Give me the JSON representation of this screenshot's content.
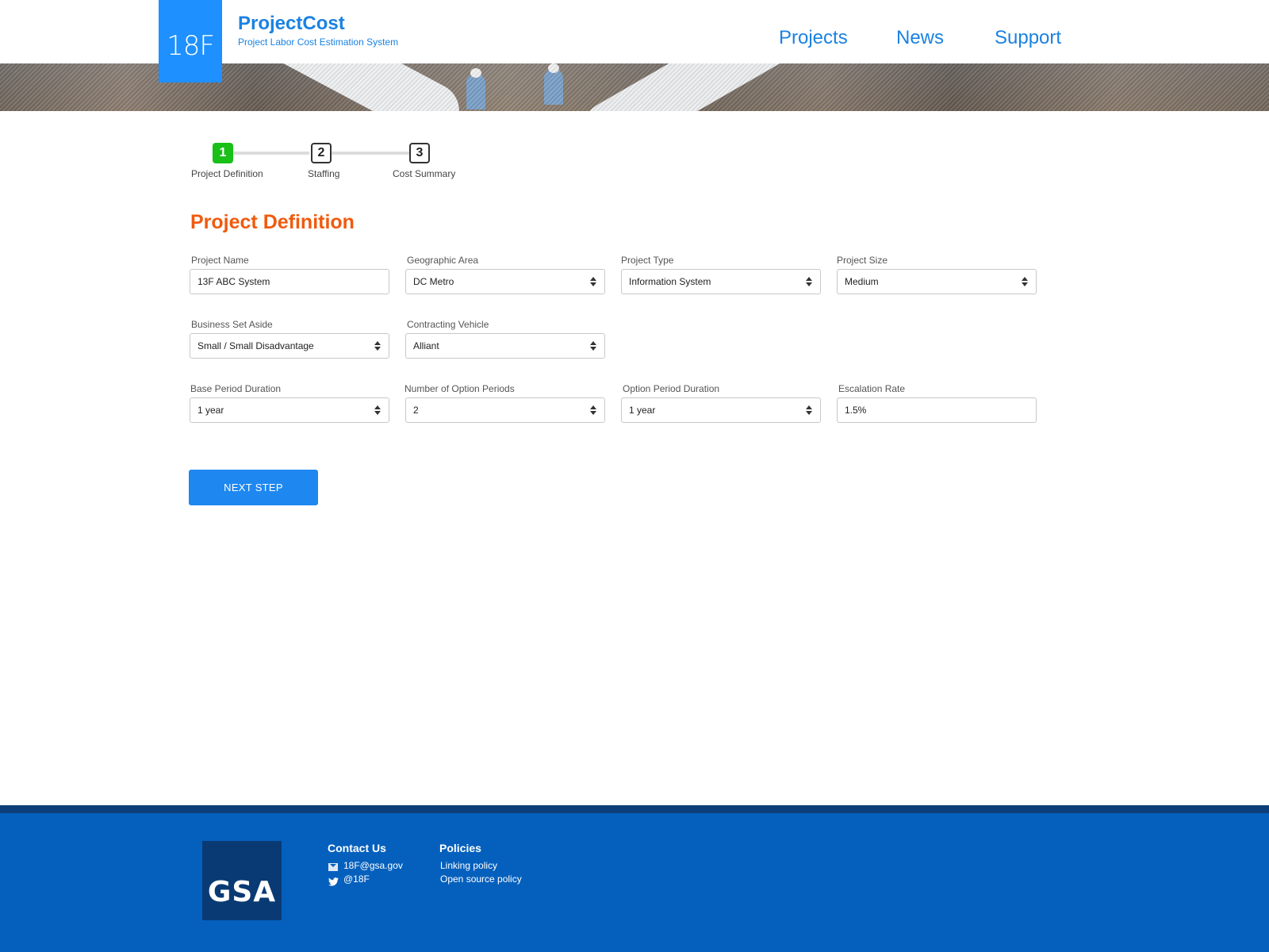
{
  "header": {
    "logo_text": "18F",
    "brand_title": "ProjectCost",
    "brand_subtitle": "Project Labor Cost Estimation System",
    "nav": [
      "Projects",
      "News",
      "Support"
    ]
  },
  "stepper": {
    "steps": [
      {
        "number": "1",
        "label": "Project Definition",
        "active": true
      },
      {
        "number": "2",
        "label": "Staffing",
        "active": false
      },
      {
        "number": "3",
        "label": "Cost Summary",
        "active": false
      }
    ]
  },
  "form": {
    "title": "Project Definition",
    "fields": {
      "project_name": {
        "label": "Project Name",
        "value": "13F ABC System"
      },
      "geographic_area": {
        "label": "Geographic Area",
        "value": "DC Metro"
      },
      "project_type": {
        "label": "Project Type",
        "value": "Information System"
      },
      "project_size": {
        "label": "Project Size",
        "value": "Medium"
      },
      "business_set_aside": {
        "label": "Business Set Aside",
        "value": "Small / Small Disadvantage"
      },
      "contracting_vehicle": {
        "label": "Contracting Vehicle",
        "value": "Alliant"
      },
      "base_period_duration": {
        "label": "Base Period Duration",
        "value": "1 year"
      },
      "number_of_option_periods": {
        "label": "Number of Option Periods",
        "value": "2"
      },
      "option_period_duration": {
        "label": "Option Period Duration",
        "value": "1 year"
      },
      "escalation_rate": {
        "label": "Escalation Rate",
        "value": "1.5%"
      }
    },
    "next_button": "NEXT STEP"
  },
  "footer": {
    "logo_text": "GSA",
    "contact_heading": "Contact Us",
    "contact_email": "18F@gsa.gov",
    "contact_twitter": "@18F",
    "policies_heading": "Policies",
    "policy_links": [
      "Linking policy",
      "Open source policy"
    ]
  },
  "colors": {
    "brand_blue": "#1e90ff",
    "heading_orange": "#f05a0e",
    "active_step_green": "#18c018",
    "footer_blue": "#0560bd"
  }
}
